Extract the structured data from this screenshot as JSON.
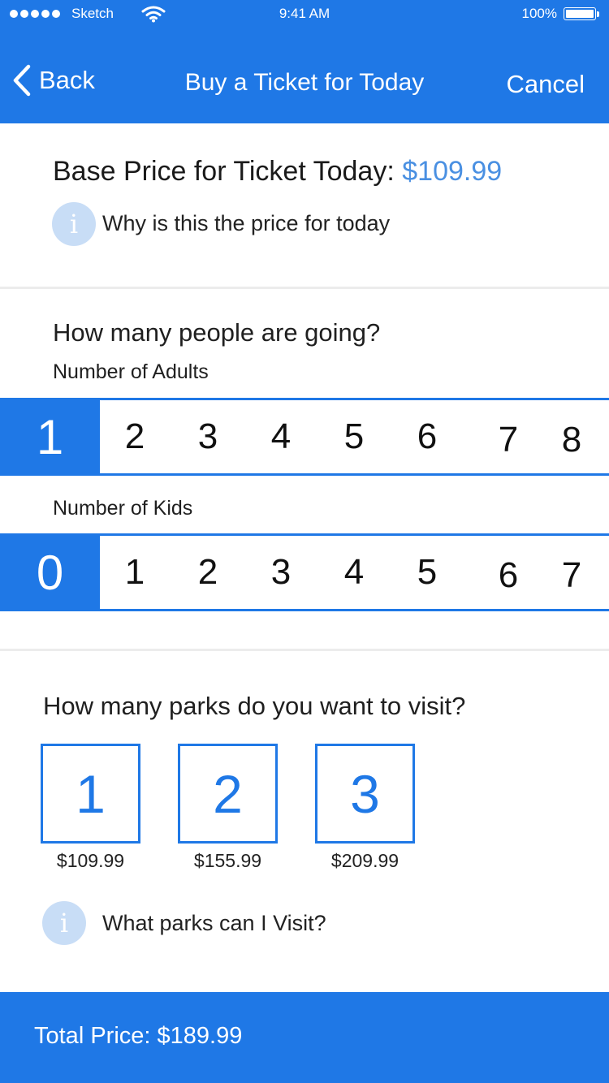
{
  "status_bar": {
    "carrier": "Sketch",
    "time": "9:41 AM",
    "battery": "100%",
    "icons": [
      "signal-dots-icon",
      "wifi-icon",
      "battery-icon"
    ]
  },
  "nav": {
    "back_label": "Back",
    "title": "Buy a Ticket for Today",
    "cancel_label": "Cancel"
  },
  "base_price": {
    "label": "Base Price for Ticket Today:",
    "value": "$109.99",
    "info_icon": "i",
    "info_text": "Why is this the price for today"
  },
  "people": {
    "title": "How many people are going?",
    "adults": {
      "label": "Number of Adults",
      "selected": "1",
      "options": [
        "2",
        "3",
        "4",
        "5",
        "6",
        "7",
        "8"
      ]
    },
    "kids": {
      "label": "Number of Kids",
      "selected": "0",
      "options": [
        "1",
        "2",
        "3",
        "4",
        "5",
        "6",
        "7"
      ]
    }
  },
  "parks": {
    "title": "How many parks do you want to visit?",
    "options": [
      {
        "label": "1",
        "price": "$109.99"
      },
      {
        "label": "2",
        "price": "$155.99"
      },
      {
        "label": "3",
        "price": "$209.99"
      }
    ],
    "info_icon": "i",
    "info_text": "What parks can I Visit?"
  },
  "footer": {
    "total_text": "Total Price: $189.99"
  },
  "colors": {
    "accent": "#1f78e6",
    "price_text": "#4a90e2",
    "info_circle": "#c8ddf6"
  }
}
